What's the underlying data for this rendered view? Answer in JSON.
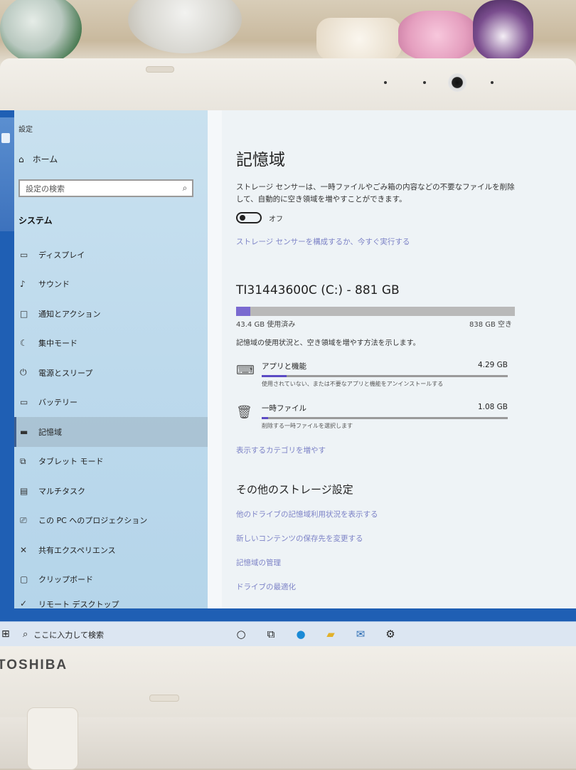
{
  "window": {
    "title": "設定"
  },
  "sidebar": {
    "home_label": "ホーム",
    "search_placeholder": "設定の検索",
    "section_label": "システム",
    "items": [
      {
        "icon": "display-icon",
        "label": "ディスプレイ"
      },
      {
        "icon": "sound-icon",
        "label": "サウンド"
      },
      {
        "icon": "notification-icon",
        "label": "通知とアクション"
      },
      {
        "icon": "focus-assist-icon",
        "label": "集中モード"
      },
      {
        "icon": "power-icon",
        "label": "電源とスリープ"
      },
      {
        "icon": "battery-icon",
        "label": "バッテリー"
      },
      {
        "icon": "storage-icon",
        "label": "記憶域",
        "selected": true
      },
      {
        "icon": "tablet-icon",
        "label": "タブレット モード"
      },
      {
        "icon": "multitask-icon",
        "label": "マルチタスク"
      },
      {
        "icon": "project-icon",
        "label": "この PC へのプロジェクション"
      },
      {
        "icon": "shared-experience-icon",
        "label": "共有エクスペリエンス"
      },
      {
        "icon": "clipboard-icon",
        "label": "クリップボード"
      },
      {
        "icon": "remote-desktop-icon",
        "label": "リモート デスクトップ"
      }
    ]
  },
  "main": {
    "title": "記憶域",
    "description": "ストレージ センサーは、一時ファイルやごみ箱の内容などの不要なファイルを削除して、自動的に空き領域を増やすことができます。",
    "toggle_state": "オフ",
    "configure_link": "ストレージ センサーを構成するか、今すぐ実行する",
    "drive": {
      "title": "TI31443600C (C:) - 881 GB",
      "used_label": "43.4 GB 使用済み",
      "free_label": "838 GB 空き",
      "used_fraction": 0.05
    },
    "hint": "記憶域の使用状況と、空き領域を増やす方法を示します。",
    "categories": [
      {
        "icon": "apps-icon",
        "name": "アプリと機能",
        "size": "4.29 GB",
        "sub": "使用されていない、または不要なアプリと機能をアンインストールする",
        "fraction": 0.1
      },
      {
        "icon": "trash-icon",
        "name": "一時ファイル",
        "size": "1.08 GB",
        "sub": "削除する一時ファイルを選択します",
        "fraction": 0.025
      }
    ],
    "more_categories_link": "表示するカテゴリを増やす",
    "other_heading": "その他のストレージ設定",
    "other_links": [
      "他のドライブの記憶域利用状況を表示する",
      "新しいコンテンツの保存先を変更する",
      "記憶域の管理",
      "ドライブの最適化"
    ]
  },
  "taskbar": {
    "search_placeholder": "ここに入力して検索",
    "icons": [
      "cortana-icon",
      "task-view-icon",
      "edge-icon",
      "explorer-icon",
      "mail-icon",
      "settings-icon"
    ]
  },
  "device": {
    "brand": "TOSHIBA"
  }
}
